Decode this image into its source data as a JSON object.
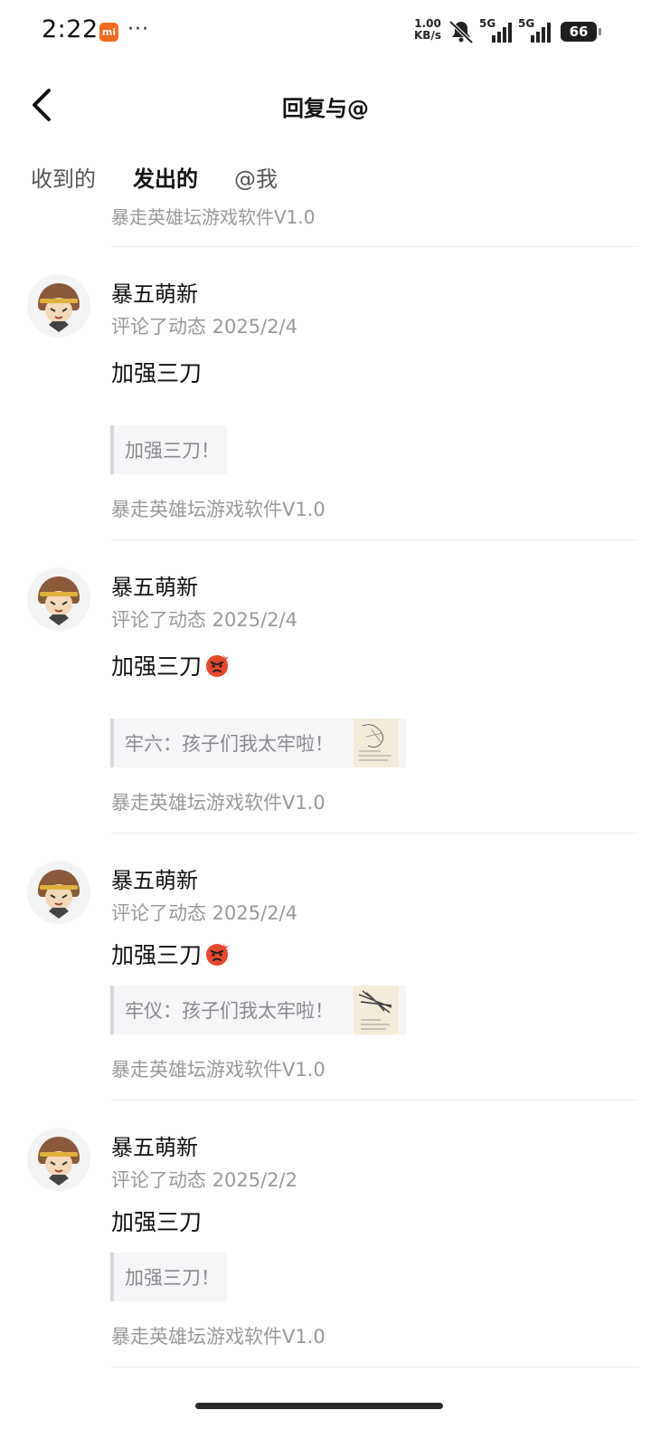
{
  "status_bar": {
    "time": "2:22",
    "mi_label": "mi",
    "more": "···",
    "speed_value": "1.00",
    "speed_unit": "KB/s",
    "signal1_label": "5G",
    "signal2_label": "5G",
    "battery": "66"
  },
  "header": {
    "title": "回复与@"
  },
  "tabs": [
    {
      "label": "收到的"
    },
    {
      "label": "发出的"
    },
    {
      "label": "@我"
    }
  ],
  "list": {
    "top_partial_source": "暴走英雄坛游戏软件V1.0",
    "items": [
      {
        "username": "暴五萌新",
        "meta": "评论了动态 2025/2/4",
        "comment": "加强三刀",
        "quote": "加强三刀！",
        "source": "暴走英雄坛游戏软件V1.0"
      },
      {
        "username": "暴五萌新",
        "meta": "评论了动态 2025/2/4",
        "comment": "加强三刀",
        "quote": "牢六：孩子们我太牢啦！",
        "source": "暴走英雄坛游戏软件V1.0"
      },
      {
        "username": "暴五萌新",
        "meta": "评论了动态 2025/2/4",
        "comment": "加强三刀",
        "quote": "牢仪：孩子们我太牢啦！",
        "source": "暴走英雄坛游戏软件V1.0"
      },
      {
        "username": "暴五萌新",
        "meta": "评论了动态 2025/2/2",
        "comment": "加强三刀",
        "quote": "加强三刀！",
        "source": "暴走英雄坛游戏软件V1.0"
      }
    ]
  }
}
